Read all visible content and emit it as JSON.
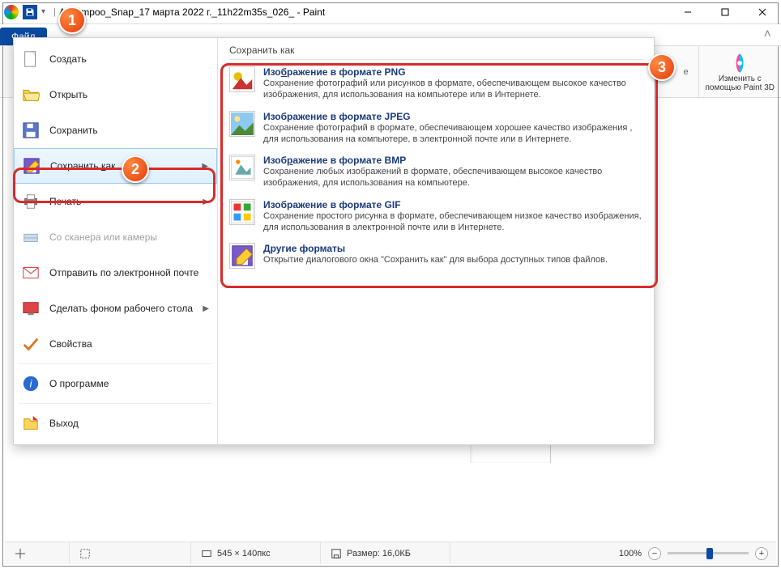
{
  "titlebar": {
    "title": "Ashampoo_Snap_17 марта 2022 г._11h22m35s_026_ - Paint",
    "qat_dropdown": "▾",
    "sep": "|"
  },
  "win": {
    "min": "",
    "max": "",
    "close": ""
  },
  "ribbon": {
    "file_tab": "Файл",
    "chevron": "˄",
    "paint3d_group": {
      "line1": "Изменить с",
      "line2": "помощью Paint 3D"
    },
    "stray_letter": "е"
  },
  "menu": {
    "create": "Создать",
    "open": "Открыть",
    "save": "Сохранить",
    "save_as_pre": "Сохранить ",
    "save_as_key": "к",
    "save_as_post": "ак",
    "print": "Печать",
    "scanner": "Со сканера или камеры",
    "send_email": "Отправить по электронной почте",
    "wallpaper": "Сделать фоном рабочего стола",
    "properties": "Свойства",
    "about": "О программе",
    "exit": "Выход"
  },
  "submenu": {
    "header": "Сохранить как",
    "png": {
      "title_pre": "Изо",
      "title_key": "б",
      "title_post": "ражение в формате PNG",
      "desc": "Сохранение фотографий или рисунков в формате, обеспечивающем высокое качество изображения, для использования на компьютере или в Интернете."
    },
    "jpeg": {
      "title": "Изображение в формате JPEG",
      "desc": "Сохранение фотографий в формате, обеспечивающем хорошее качество изображения , для использования на компьютере, в электронной почте или в Интернете."
    },
    "bmp": {
      "title_pre": "Изоб",
      "title_key": "р",
      "title_post": "ажение в формате BMP",
      "desc": "Сохранение любых изображений в формате, обеспечивающем высокое качество изображения, для использования на компьютере."
    },
    "gif": {
      "title": "Изображение в формате GIF",
      "desc": "Сохранение простого рисунка в формате, обеспечивающем низкое качество изображения, для использования в электронной почте или в Интернете."
    },
    "other": {
      "title_pre": "",
      "title_key": "Д",
      "title_post": "ругие форматы",
      "desc": "Открытие диалогового окна \"Сохранить как\" для выбора доступных типов файлов."
    }
  },
  "status": {
    "cursor": "",
    "selection": "",
    "dims": "545 × 140пкс",
    "size": "Размер: 16,0КБ",
    "zoom_pct": "100%"
  },
  "badges": {
    "b1": "1",
    "b2": "2",
    "b3": "3"
  }
}
